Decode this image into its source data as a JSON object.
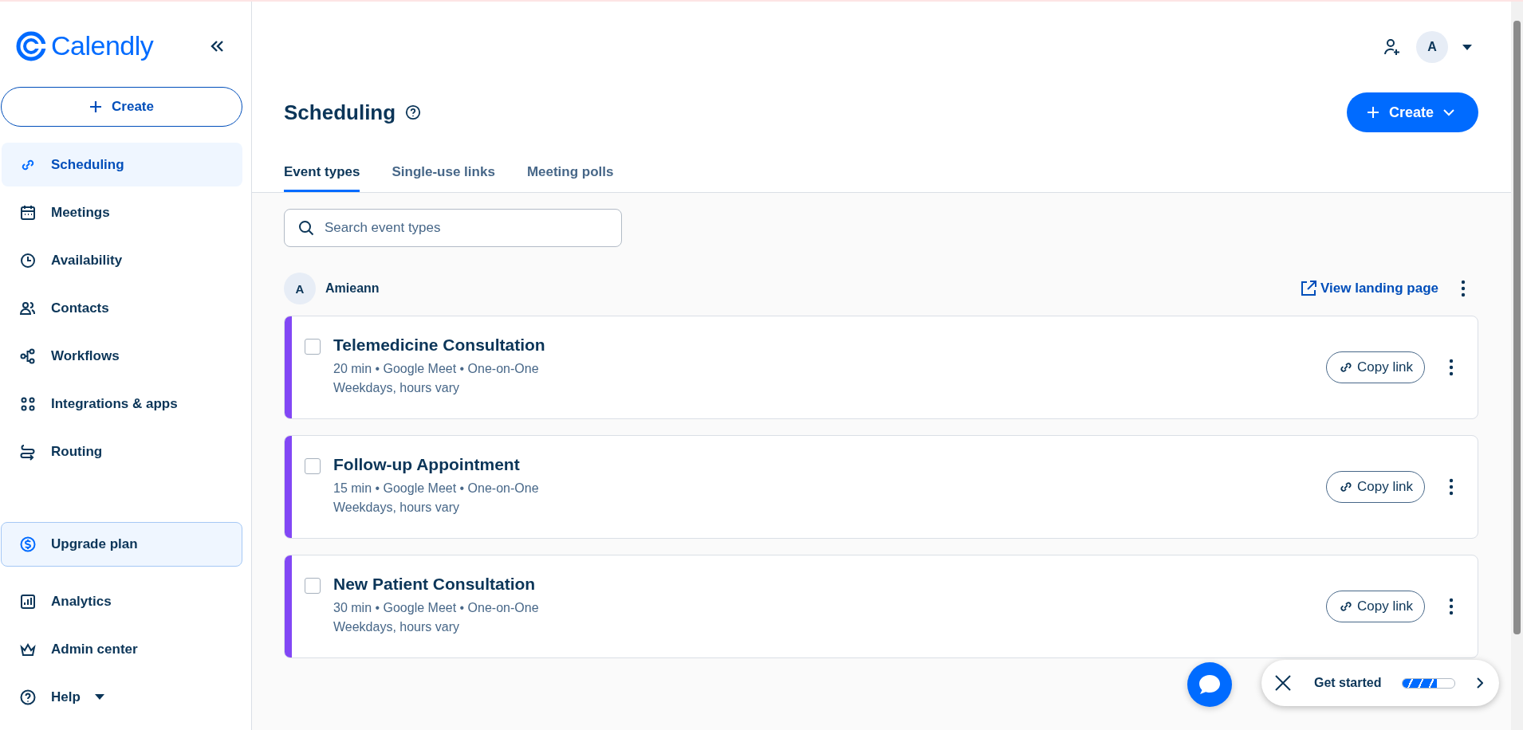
{
  "sidebar": {
    "logo": "Calendly",
    "create_button": "Create",
    "nav_items": [
      {
        "label": "Scheduling",
        "selected": true
      },
      {
        "label": "Meetings",
        "selected": false
      },
      {
        "label": "Availability",
        "selected": false
      },
      {
        "label": "Contacts",
        "selected": false
      },
      {
        "label": "Workflows",
        "selected": false
      },
      {
        "label": "Integrations & apps",
        "selected": false
      },
      {
        "label": "Routing",
        "selected": false
      }
    ],
    "upgrade_button": "Upgrade plan",
    "bottom_items": [
      {
        "label": "Analytics",
        "kind": "link"
      },
      {
        "label": "Admin center",
        "kind": "link"
      },
      {
        "label": "Help",
        "kind": "menu"
      }
    ]
  },
  "header": {
    "avatar": "A"
  },
  "page": {
    "title": "Scheduling",
    "create_button": "Create",
    "tabs": [
      {
        "label": "Event types",
        "selected": true
      },
      {
        "label": "Single-use links",
        "selected": false
      },
      {
        "label": "Meeting polls",
        "selected": false
      }
    ],
    "search": {
      "placeholder": "Search event types"
    },
    "owner": {
      "avatar": "A",
      "name": "Amieann",
      "link": "View landing page"
    },
    "event_types": [
      {
        "title": "Telemedicine Consultation",
        "details": "20 min • Google Meet • One-on-One",
        "availability": "Weekdays, hours vary",
        "color": "#8247f5",
        "checked": false,
        "button": "Copy link"
      },
      {
        "title": "Follow-up Appointment",
        "details": "15 min • Google Meet • One-on-One",
        "availability": "Weekdays, hours vary",
        "color": "#8247f5",
        "checked": false,
        "button": "Copy link"
      },
      {
        "title": "New Patient Consultation",
        "details": "30 min • Google Meet • One-on-One",
        "availability": "Weekdays, hours vary",
        "color": "#8247f5",
        "checked": false,
        "button": "Copy link"
      }
    ]
  },
  "get_started": {
    "label": "Get started",
    "level": 0.65
  }
}
